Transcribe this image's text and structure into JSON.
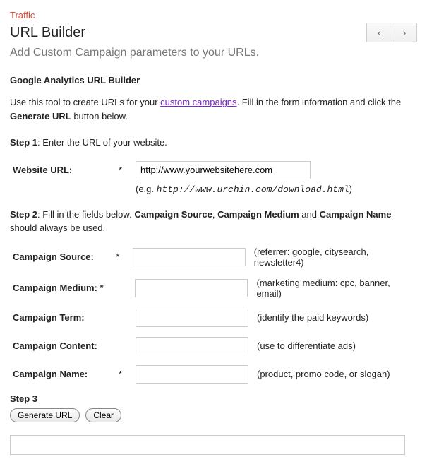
{
  "header": {
    "category": "Traffic",
    "title": "URL Builder",
    "subtitle": "Add Custom Campaign parameters to your URLs."
  },
  "section_heading": "Google Analytics URL Builder",
  "intro": {
    "part1": "Use this tool to create URLs for your ",
    "link_text": "custom campaigns",
    "part2": ". Fill in the form information and click the ",
    "bold": "Generate URL",
    "part3": " button below."
  },
  "step1": {
    "label": "Step 1",
    "text": ": Enter the URL of your website."
  },
  "website_url": {
    "label": "Website URL:",
    "required": "*",
    "value": "http://www.yourwebsitehere.com",
    "example_prefix": "(e.g. ",
    "example_mono": "http://www.urchin.com/download.html",
    "example_suffix": ")"
  },
  "step2": {
    "label": "Step 2",
    "text_a": ": Fill in the fields below. ",
    "b1": "Campaign Source",
    "sep1": ", ",
    "b2": "Campaign Medium",
    "sep2": " and ",
    "b3": "Campaign Name",
    "text_b": " should always be used."
  },
  "fields": {
    "source": {
      "label": "Campaign Source:",
      "required": "*",
      "hint": "(referrer: google, citysearch, newsletter4)"
    },
    "medium": {
      "label": "Campaign Medium: *",
      "required": "",
      "hint": "(marketing medium: cpc, banner, email)"
    },
    "term": {
      "label": "Campaign Term:",
      "required": "",
      "hint": "(identify the paid keywords)"
    },
    "content": {
      "label": "Campaign Content:",
      "required": "",
      "hint": "(use to differentiate ads)"
    },
    "name": {
      "label": "Campaign Name:",
      "required": "*",
      "hint": "(product, promo code, or slogan)"
    }
  },
  "step3": {
    "label": "Step 3"
  },
  "buttons": {
    "generate": "Generate URL",
    "clear": "Clear"
  }
}
